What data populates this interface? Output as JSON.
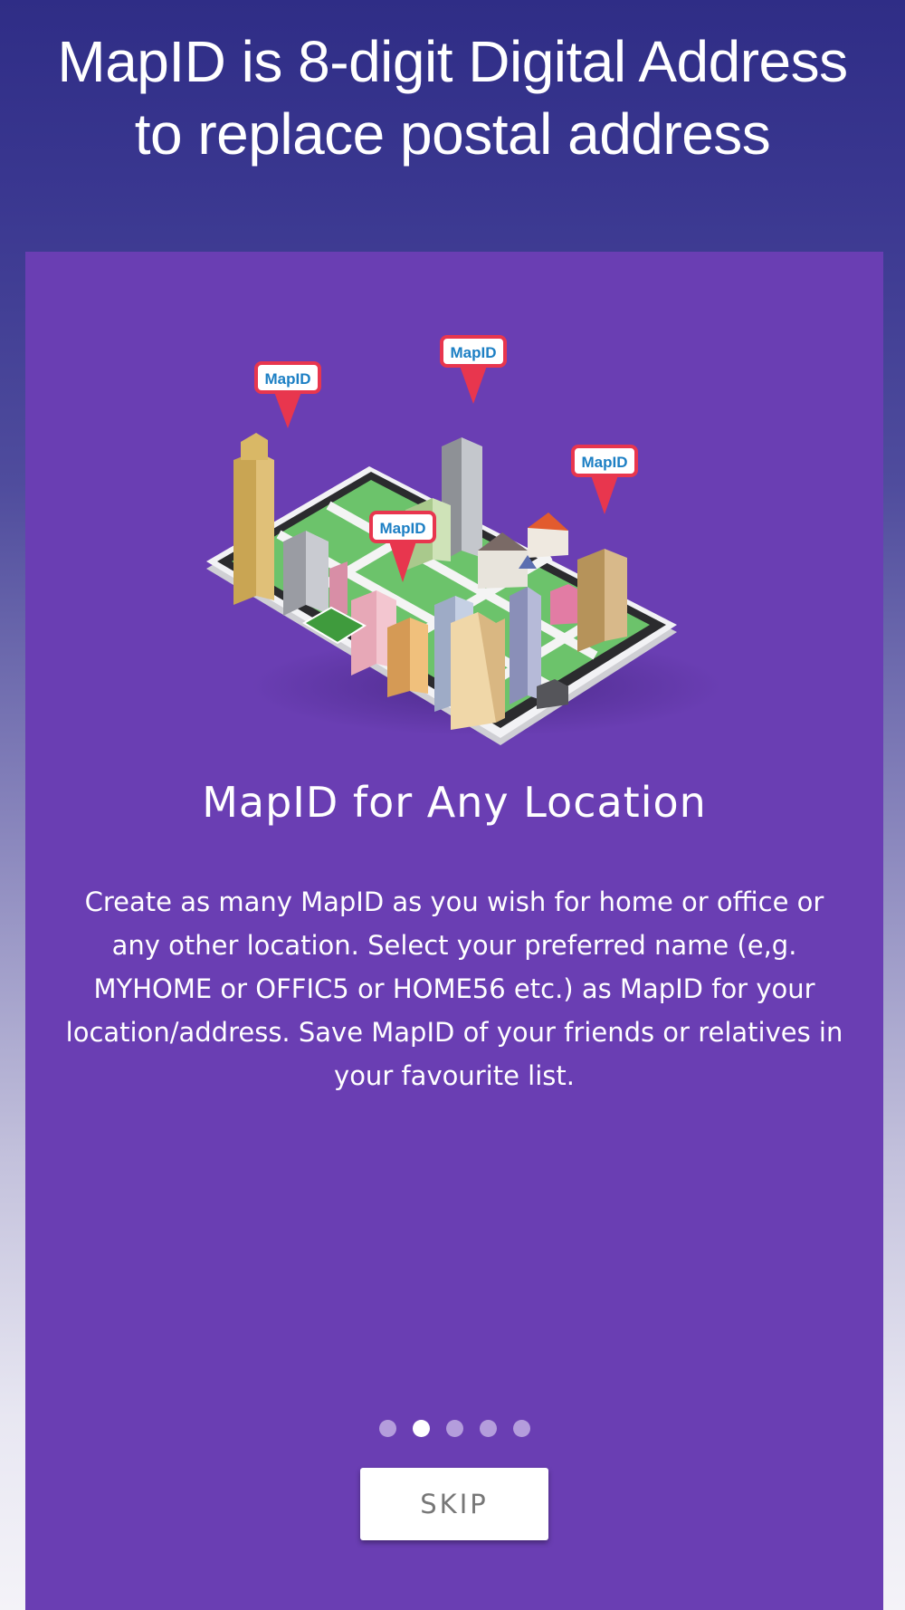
{
  "header": {
    "line1": "MapID is 8-digit Digital Address",
    "line2": "to replace postal address"
  },
  "slide": {
    "title": "MapID for Any Location",
    "description": "Create as many MapID as you wish for home or office or any other location. Select your preferred name (e,g. MYHOME or OFFIC5 or HOME56 etc.) as MapID for your location/address. Save MapID of your friends or relatives in your favourite list.",
    "pin_label": "MapID"
  },
  "pagination": {
    "total": 5,
    "active_index": 1
  },
  "skip_label": "SKIP",
  "colors": {
    "header_bg": "#2f2d86",
    "card_bg": "#6a3eb3",
    "dot_inactive": "#b49ddc",
    "dot_active": "#ffffff",
    "pin": "#e8364e"
  }
}
